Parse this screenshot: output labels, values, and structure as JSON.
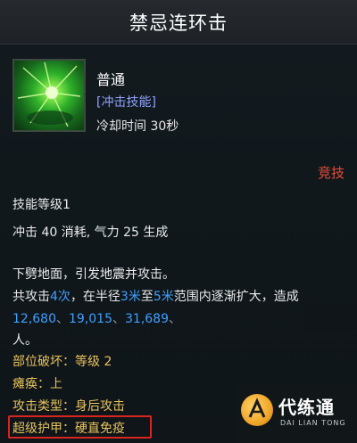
{
  "header": {
    "title": "禁忌连环击"
  },
  "skill": {
    "name": "普通",
    "tag": "[冲击技能]",
    "cooldown": "冷却时间 30秒",
    "badge": "竞技",
    "level": "技能等级1",
    "cost": "冲击 40 消耗, 气力 25 生成"
  },
  "description": {
    "line1": "下劈地面，引发地震并攻击。",
    "line2_a": "共攻击",
    "line2_count": "4次",
    "line2_b": "，在半径",
    "line2_r1": "3米",
    "line2_c": "至",
    "line2_r2": "5米",
    "line2_d": "范围内逐渐扩大，造成",
    "damage_1": "12,680",
    "damage_2": "19,015",
    "damage_3": "31,689",
    "line4": "人。"
  },
  "stats": {
    "part_break_label": "部位破坏：",
    "part_break_value": "等级 2",
    "paralysis_label": "瘫痪：",
    "paralysis_value": "上",
    "attack_type_label": "攻击类型：",
    "attack_type_value": "身后攻击",
    "super_armor_label": "超级护甲：",
    "super_armor_value": "硬直免疫"
  },
  "watermark": {
    "title": "代练通",
    "subtitle": "DAI LIAN TONG"
  },
  "colors": {
    "accent_blue": "#3ea0ff",
    "tag_purple": "#8fa2ff",
    "badge_red": "#e84d3a",
    "label_yellow": "#e7c25a",
    "highlight_border": "#d8261e"
  }
}
